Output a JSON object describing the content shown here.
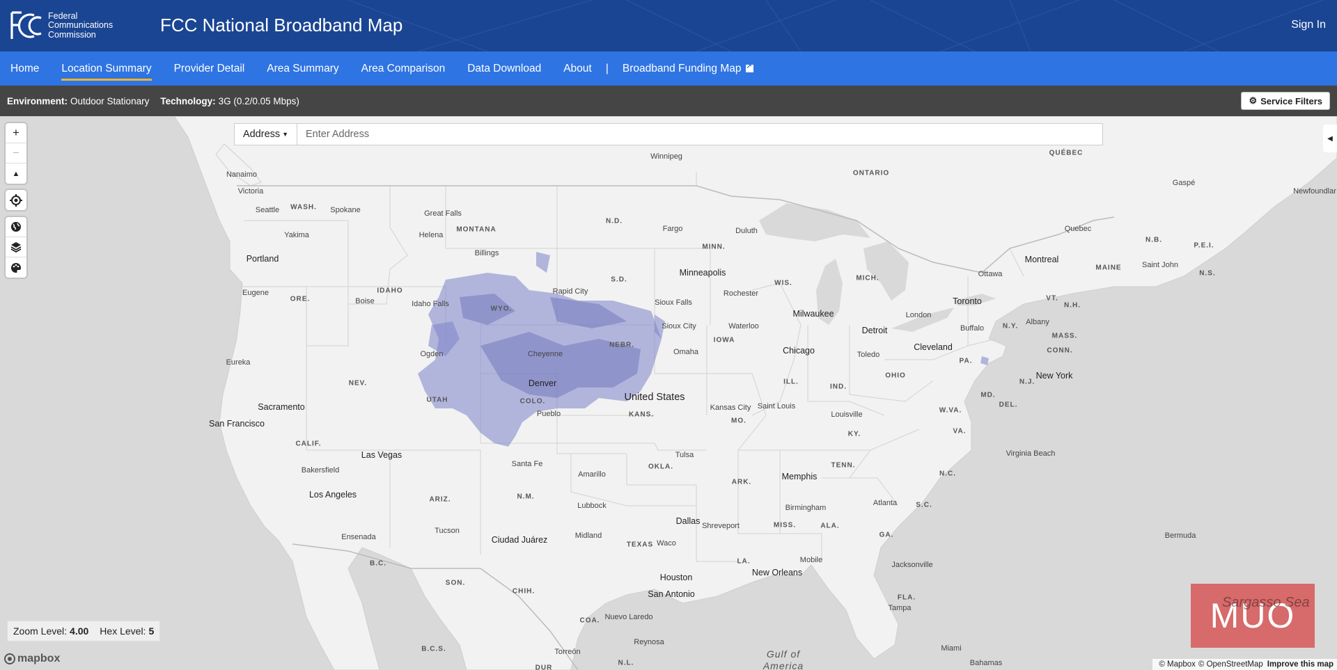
{
  "header": {
    "agency_name": [
      "Federal",
      "Communications",
      "Commission"
    ],
    "logo_text": "FCC",
    "app_title": "FCC National Broadband Map",
    "sign_in_label": "Sign In"
  },
  "nav": {
    "items": [
      {
        "label": "Home",
        "active": false
      },
      {
        "label": "Location Summary",
        "active": true
      },
      {
        "label": "Provider Detail",
        "active": false
      },
      {
        "label": "Area Summary",
        "active": false
      },
      {
        "label": "Area Comparison",
        "active": false
      },
      {
        "label": "Data Download",
        "active": false
      },
      {
        "label": "About",
        "active": false
      }
    ],
    "separator": "|",
    "external_link_label": "Broadband Funding Map"
  },
  "filters": {
    "environment_label": "Environment:",
    "environment_value": "Outdoor Stationary",
    "technology_label": "Technology:",
    "technology_value": "3G (0.2/0.05 Mbps)",
    "service_filters_label": "Service Filters"
  },
  "search": {
    "type_label": "Address",
    "placeholder": "Enter Address",
    "value": ""
  },
  "map_controls": {
    "zoom_in": "+",
    "zoom_out": "−",
    "compass": "▲"
  },
  "map_status": {
    "zoom_label": "Zoom Level:",
    "zoom_value": "4.00",
    "hex_label": "Hex Level:",
    "hex_value": "5"
  },
  "map_labels": {
    "cities": [
      "Winnipeg",
      "Nanaimo",
      "Victoria",
      "Seattle",
      "Spokane",
      "Great Falls",
      "Helena",
      "Yakima",
      "Portland",
      "Billings",
      "Fargo",
      "Duluth",
      "Eugene",
      "Boise",
      "Idaho Falls",
      "Rapid City",
      "Minneapolis",
      "Rochester",
      "Sioux Falls",
      "Sioux City",
      "Waterloo",
      "Milwaukee",
      "Ogden",
      "Cheyenne",
      "Omaha",
      "Chicago",
      "Detroit",
      "Toledo",
      "London",
      "Toronto",
      "Buffalo",
      "Ottawa",
      "Montreal",
      "Quebec",
      "Gaspé",
      "Saint John",
      "Albany",
      "Cleveland",
      "New York",
      "Eureka",
      "Denver",
      "Pueblo",
      "Kansas City",
      "Saint Louis",
      "Louisville",
      "Sacramento",
      "San Francisco",
      "Las Vegas",
      "Bakersfield",
      "Los Angeles",
      "Santa Fe",
      "Amarillo",
      "Tulsa",
      "Memphis",
      "Virginia Beach",
      "Lubbock",
      "Dallas",
      "Shreveport",
      "Birmingham",
      "Atlanta",
      "Ensenada",
      "Tucson",
      "Ciudad Juárez",
      "Midland",
      "Waco",
      "Houston",
      "San Antonio",
      "New Orleans",
      "Mobile",
      "Jacksonville",
      "Tampa",
      "Miami",
      "Nuevo Laredo",
      "Reynosa",
      "Torreón",
      "Bermuda",
      "Bahamas",
      "Newfoundlar"
    ],
    "states": [
      "QUÉBEC",
      "ONTARIO",
      "WASH.",
      "MONTANA",
      "N.D.",
      "MINN.",
      "S.D.",
      "WIS.",
      "MICH.",
      "ORE.",
      "IDAHO",
      "WYO.",
      "NEBR.",
      "IOWA",
      "MAINE",
      "N.B.",
      "P.E.I.",
      "N.S.",
      "VT.",
      "N.H.",
      "N.Y.",
      "MASS.",
      "CONN.",
      "PA.",
      "OHIO",
      "N.J.",
      "NEV.",
      "UTAH",
      "COLO.",
      "KANS.",
      "MO.",
      "ILL.",
      "IND.",
      "W.VA.",
      "VA.",
      "MD.",
      "DEL.",
      "KY.",
      "CALIF.",
      "ARIZ.",
      "N.M.",
      "OKLA.",
      "ARK.",
      "TENN.",
      "N.C.",
      "S.C.",
      "MISS.",
      "ALA.",
      "GA.",
      "TEXAS",
      "LA.",
      "FLA.",
      "B.C.",
      "SON.",
      "CHIH.",
      "COA.",
      "N.L.",
      "B.C.S.",
      "DUR"
    ],
    "country": "United States",
    "water_lines": [
      "Gulf of",
      "America"
    ]
  },
  "attribution": {
    "mapbox_logo": "mapbox",
    "mapbox": "© Mapbox",
    "osm": "© OpenStreetMap",
    "improve": "Improve this map"
  },
  "watermark": {
    "text": "MUO",
    "underlay": "Sargasso Sea"
  },
  "colors": {
    "header_bg": "#1a4593",
    "nav_bg": "#2f74e3",
    "nav_active_underline": "#f3b52b",
    "filter_bar_bg": "#454545",
    "land": "#f2f2f2",
    "water": "#d9d9d9",
    "coverage_hex": "#7b83c9"
  },
  "icons": {
    "search_type_caret": "chevron-down-icon",
    "service_filters": "gear-icon",
    "geolocate": "crosshair-icon",
    "basemap": "globe-icon",
    "layers": "layers-icon",
    "style": "palette-icon",
    "side_panel_toggle": "chevron-left-icon",
    "external_link": "external-link-icon"
  }
}
